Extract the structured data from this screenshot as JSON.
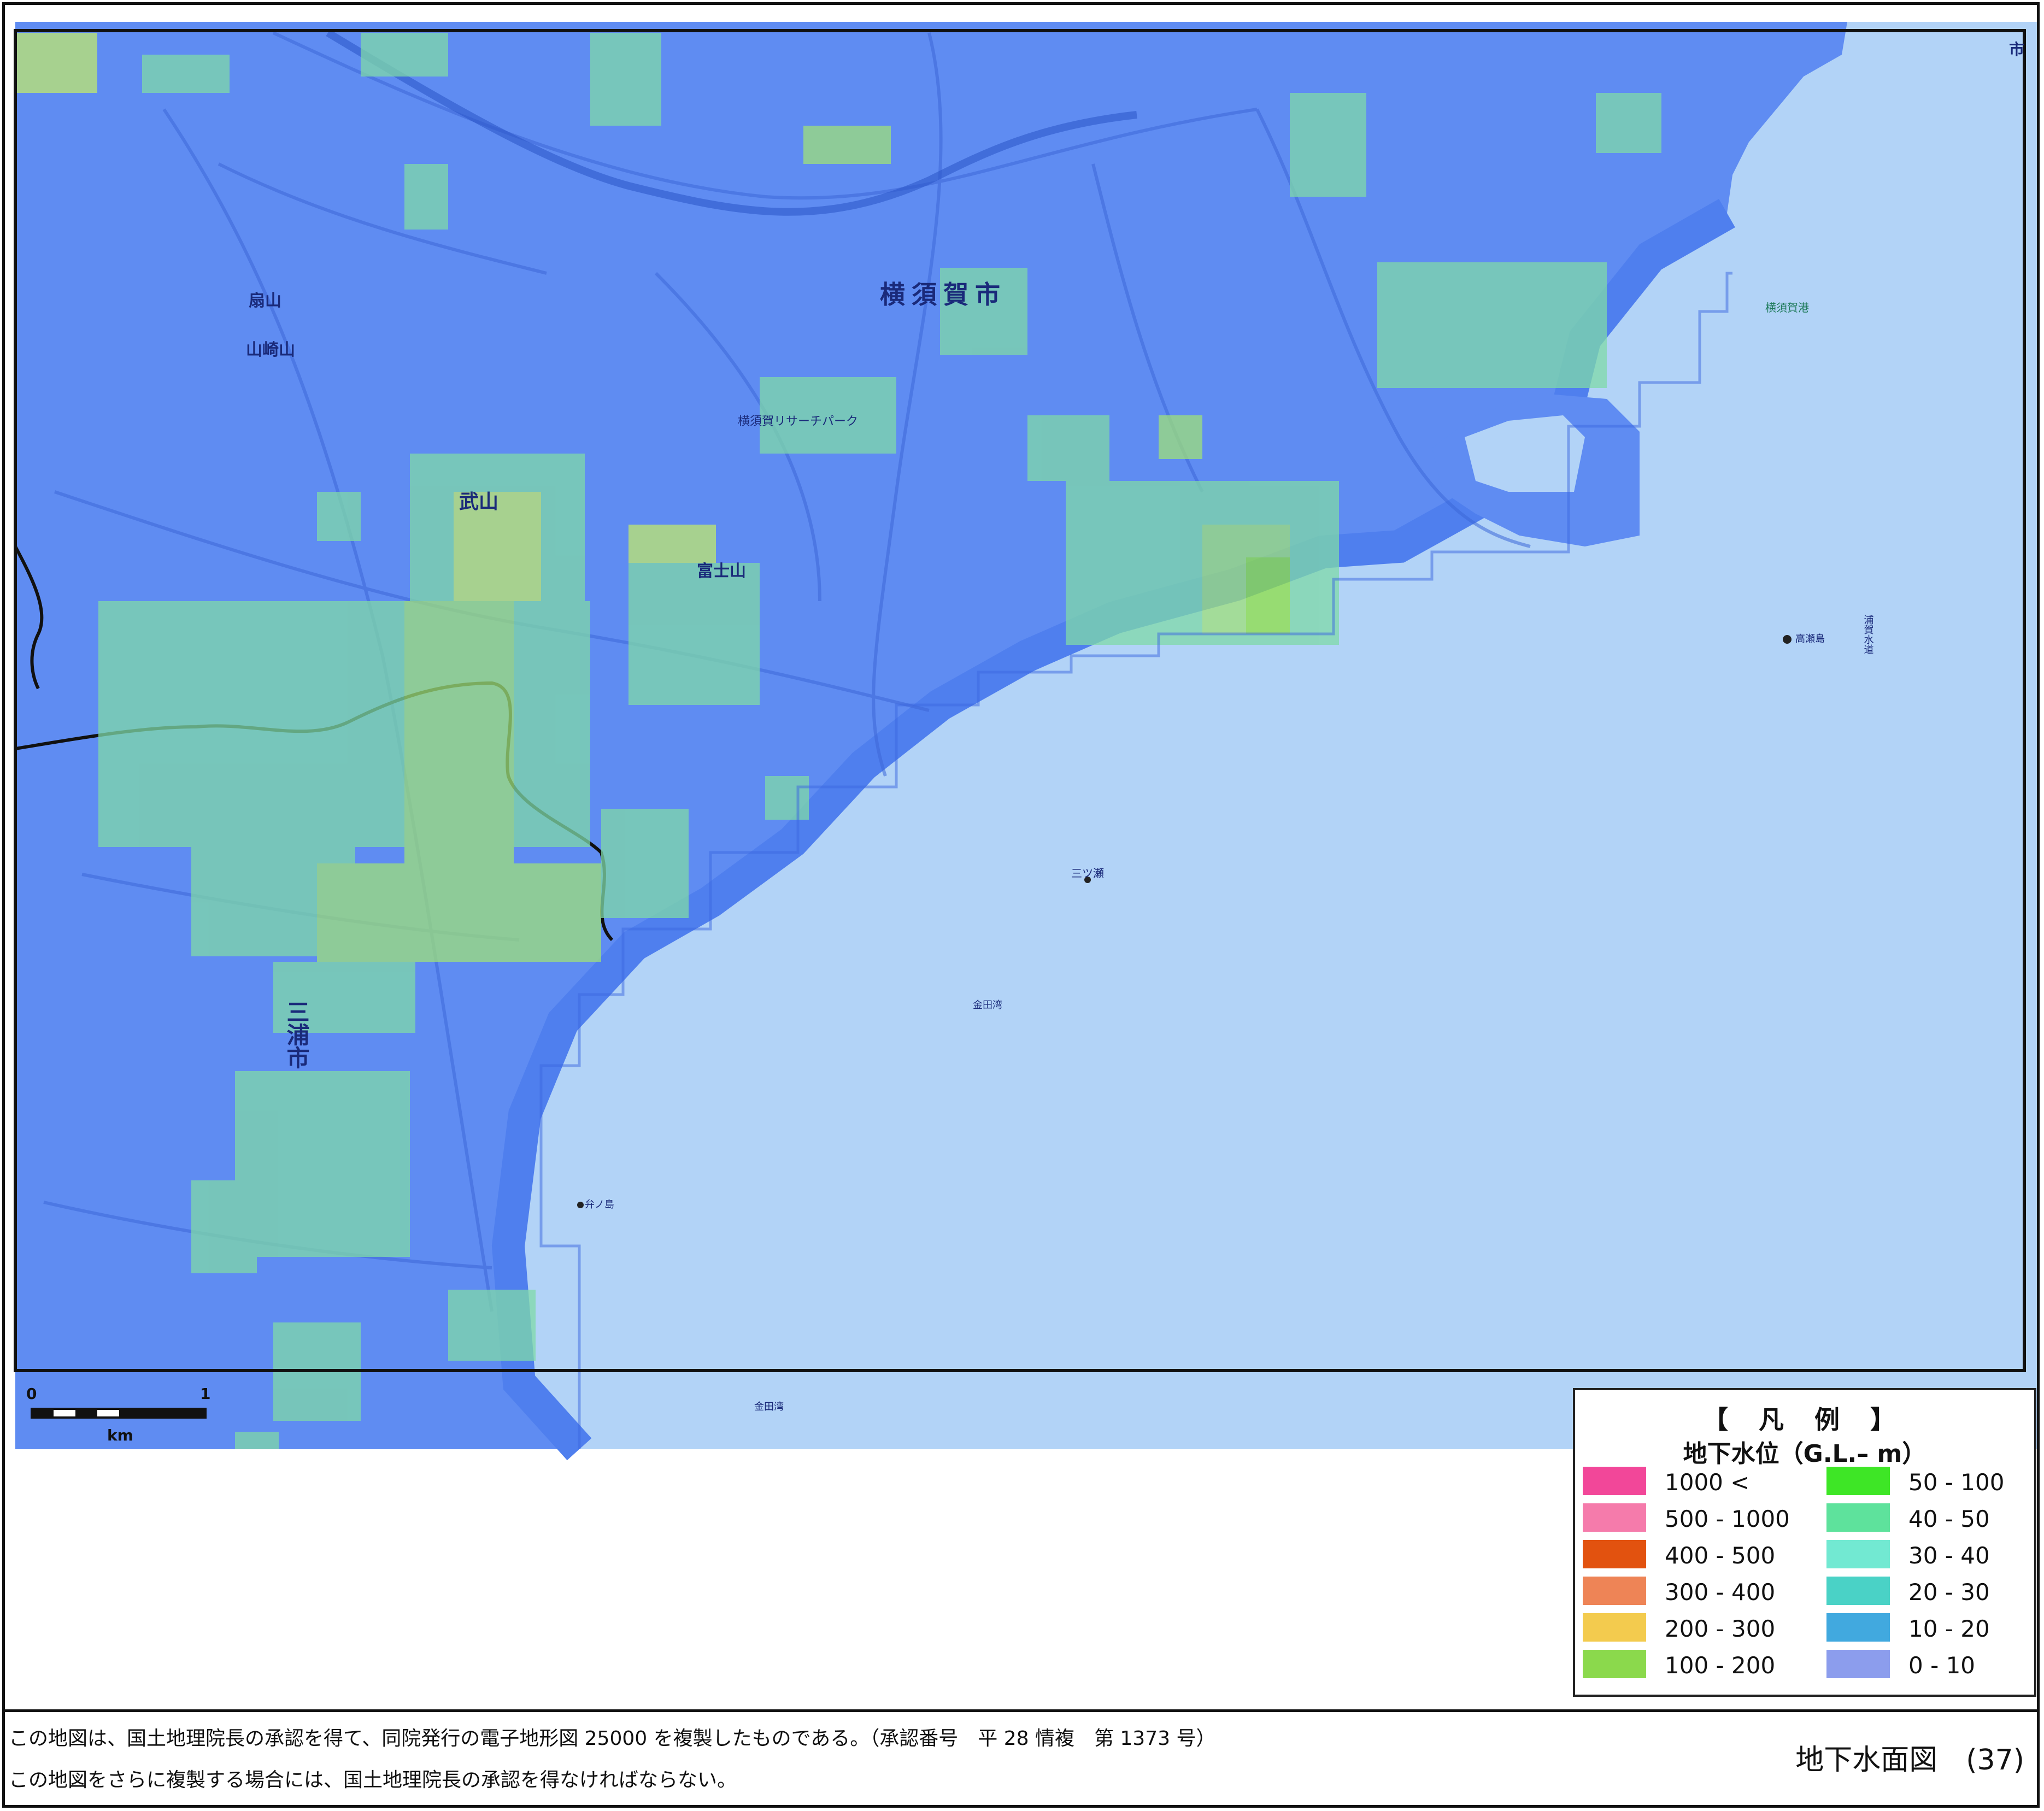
{
  "map": {
    "city_yokosuka": "横須賀市",
    "city_miura": "三浦市",
    "place_takeyama": "武山",
    "place_fujiyama": "富士山",
    "place_ogisan": "扇山",
    "place_yamazakiyama": "山崎山",
    "place_mitsuse": "三ツ瀬",
    "place_kanedawan": "金田湾",
    "place_kanedawan2": "金田湾",
    "place_inonoshima": "弁ノ島",
    "place_uraga_suido": "浦賀水道",
    "place_takasejima": "高瀬島",
    "place_yokosuka_port": "横須賀港",
    "place_kannonzaki_corner": "市",
    "place_lisurt_park": "横須賀リサーチパーク",
    "colors": {
      "sea": "#b2d3f7",
      "land": "#5f8cf2",
      "land_dark": "#4a76e6",
      "band_coast": "#6c9cf0",
      "cell_green": "#7fd9a8",
      "cell_yellow": "#bfe86e"
    }
  },
  "legend": {
    "title": "【 凡 例 】",
    "subtitle": "地下水位（G.L.– m）",
    "items": [
      {
        "label": "1000 <",
        "color": "#f24799"
      },
      {
        "label": "500 - 1000",
        "color": "#f57bab"
      },
      {
        "label": "400 - 500",
        "color": "#e2520f"
      },
      {
        "label": "300 - 400",
        "color": "#ee8456"
      },
      {
        "label": "200 - 300",
        "color": "#f3cb4e"
      },
      {
        "label": "100 - 200",
        "color": "#8bd94c"
      },
      {
        "label": "50 - 100",
        "color": "#3ee626"
      },
      {
        "label": "40 - 50",
        "color": "#5ee29c"
      },
      {
        "label": "30 - 40",
        "color": "#72e9d2"
      },
      {
        "label": "20 - 30",
        "color": "#4ad2c6"
      },
      {
        "label": "10 - 20",
        "color": "#41a9df"
      },
      {
        "label": "0 - 10",
        "color": "#8c9ded"
      }
    ]
  },
  "scale_bar": {
    "zero": "0",
    "one": "1",
    "unit": "km"
  },
  "footer": {
    "notice1": "この地図は、国土地理院長の承認を得て、同院発行の電子地形図 25000 を複製したものである。（承認番号　平 28 情複　第 1373 号）",
    "notice2": "この地図をさらに複製する場合には、国土地理院長の承認を得なければならない。",
    "sheet_title": "地下水面図　(37)"
  }
}
